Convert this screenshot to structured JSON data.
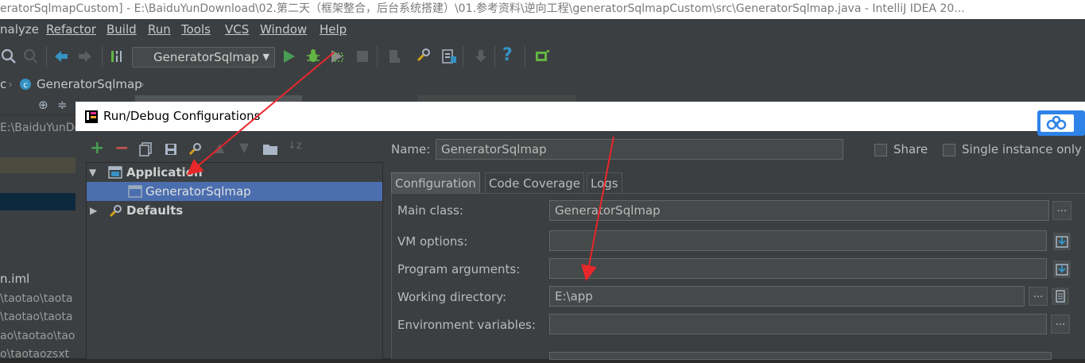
{
  "window": {
    "title": "eratorSqlmapCustom] - E:\\BaiduYunDownload\\02.第二天（框架整合，后台系统搭建）\\01.参考资料\\逆向工程\\generatorSqlmapCustom\\src\\GeneratorSqlmap.java - IntelliJ IDEA 20..."
  },
  "menu": [
    "nalyze",
    "Refactor",
    "Build",
    "Run",
    "Tools",
    "VCS",
    "Window",
    "Help"
  ],
  "toolbar": {
    "run_config": "GeneratorSqlmap",
    "help_glyph": "?"
  },
  "navbar": {
    "prefix": "c",
    "crumb": "GeneratorSqlmap"
  },
  "ide_panel": {
    "path": "E:\\BaiduYunDo",
    "rows": [
      "n.iml",
      "\\taotao\\taota",
      "\\taotao\\taota",
      "ao\\taotao\\taotao-",
      "o\\taotaozsxt"
    ]
  },
  "dialog": {
    "title": "Run/Debug Configurations",
    "tree": {
      "application": "Application",
      "item": "GeneratorSqlmap",
      "defaults": "Defaults"
    },
    "name_label": "Name:",
    "name_value": "GeneratorSqlmap",
    "share_label": "Share",
    "single_label": "Single instance only",
    "tabs": [
      "Configuration",
      "Code Coverage",
      "Logs"
    ],
    "fields": {
      "main_class_label": "Main class:",
      "main_class_value": "GeneratorSqlmap",
      "vm_options_label": "VM options:",
      "vm_options_value": "",
      "program_args_label": "Program arguments:",
      "program_args_value": "",
      "working_dir_label": "Working directory:",
      "working_dir_value": "E:\\app",
      "env_vars_label": "Environment variables:",
      "env_vars_value": ""
    },
    "ellipsis": "..."
  },
  "colors": {
    "run_green": "#499c54",
    "debug_green": "#62b543",
    "remove_red": "#c75450",
    "annotation_red": "#e8272a",
    "selection_blue": "#4b6eaf",
    "help_blue": "#3592c4"
  }
}
